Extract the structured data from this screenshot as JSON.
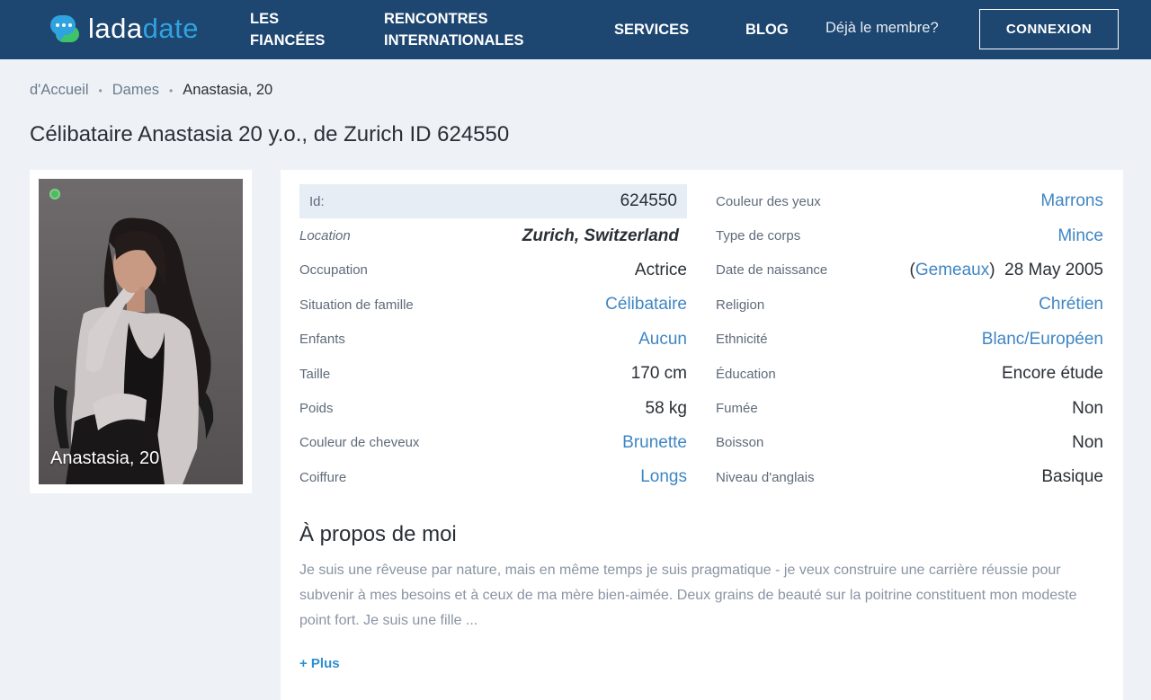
{
  "header": {
    "logo_part1": "lada",
    "logo_part2": "date",
    "nav": {
      "fiancees_line1": "LES",
      "fiancees_line2": "FIANCÉES",
      "rencontres_line1": "RENCONTRES",
      "rencontres_line2": "INTERNATIONALES",
      "services": "SERVICES",
      "blog": "BLOG"
    },
    "member_text": "Déjà le membre?",
    "login_label": "CONNEXION"
  },
  "breadcrumb": {
    "home": "d'Accueil",
    "section": "Dames",
    "current": "Anastasia, 20"
  },
  "page_title": "Célibataire Anastasia 20 y.o., de Zurich ID 624550",
  "profile": {
    "photo_caption": "Anastasia, 20",
    "left": [
      {
        "label": "Id:",
        "value": "624550"
      },
      {
        "label": "Location",
        "value": "Zurich, Switzerland"
      },
      {
        "label": "Occupation",
        "value": "Actrice"
      },
      {
        "label": "Situation de famille",
        "value": "Célibataire"
      },
      {
        "label": "Enfants",
        "value": "Aucun"
      },
      {
        "label": "Taille",
        "value": "170 cm"
      },
      {
        "label": "Poids",
        "value": "58 kg"
      },
      {
        "label": "Couleur de cheveux",
        "value": "Brunette"
      },
      {
        "label": "Coiffure",
        "value": "Longs"
      }
    ],
    "right": [
      {
        "label": "Couleur des yeux",
        "value": "Marrons"
      },
      {
        "label": "Type de corps",
        "value": "Mince"
      },
      {
        "label": "Date de naissance",
        "zodiac_open": "(",
        "zodiac": "Gemeaux",
        "zodiac_close": ")",
        "value": "28 May 2005"
      },
      {
        "label": "Religion",
        "value": "Chrétien"
      },
      {
        "label": "Ethnicité",
        "value": "Blanc/Européen"
      },
      {
        "label": "Éducation",
        "value": "Encore étude"
      },
      {
        "label": "Fumée",
        "value": "Non"
      },
      {
        "label": "Boisson",
        "value": "Non"
      },
      {
        "label": "Niveau d'anglais",
        "value": "Basique"
      }
    ],
    "about_title": "À propos de moi",
    "about_text": "Je suis une rêveuse par nature, mais en même temps je suis pragmatique - je veux construire une carrière réussie pour subvenir à mes besoins et à ceux de ma mère bien-aimée. Deux grains de beauté sur la poitrine constituent mon modeste point fort. Je suis une fille ...",
    "more_label": "+ Plus"
  },
  "colors": {
    "header_bg": "#1d4670",
    "link": "#3f86c3",
    "accent_blue": "#2fa3df",
    "accent_green": "#3fc36a",
    "online": "#4dbb5f"
  },
  "icons": [
    "chat-bubble-logo-icon",
    "online-status-icon"
  ]
}
